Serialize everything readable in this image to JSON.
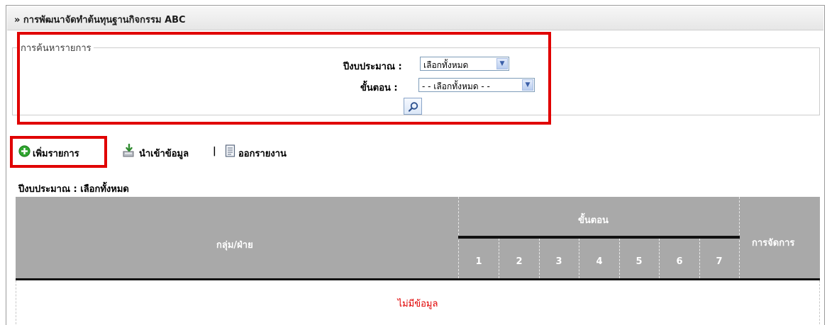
{
  "header": {
    "title": "» การพัฒนาจัดทำต้นทุนฐานกิจกรรม ABC"
  },
  "search": {
    "legend": "การค้นหารายการ",
    "year_label": "ปีงบประมาณ :",
    "year_value": "เลือกทั้งหมด",
    "step_label": "ขั้นตอน :",
    "step_value": "- - เลือกทั้งหมด - -",
    "search_button_icon": "search-icon"
  },
  "toolbar": {
    "add_label": "เพิ่มรายการ",
    "separator": "|",
    "import_label": "นำเข้าข้อมูล",
    "report_label": "ออกรายงาน",
    "icons": {
      "add": "plus-circle-icon",
      "import": "import-icon",
      "report": "report-icon"
    },
    "add_icon_color": "#2fa52f"
  },
  "filter_label": "ปีงบประมาณ : เลือกทั้งหมด",
  "table": {
    "col_group": "กลุ่ม/ฝ่าย",
    "col_steps": "ขั้นตอน",
    "col_manage": "การจัดการ",
    "steps": [
      "1",
      "2",
      "3",
      "4",
      "5",
      "6",
      "7"
    ],
    "empty_text": "ไม่มีข้อมูล"
  },
  "colors": {
    "header_bg": "#a9a9a9",
    "highlight": "#e00000",
    "empty_text": "#e00000"
  }
}
